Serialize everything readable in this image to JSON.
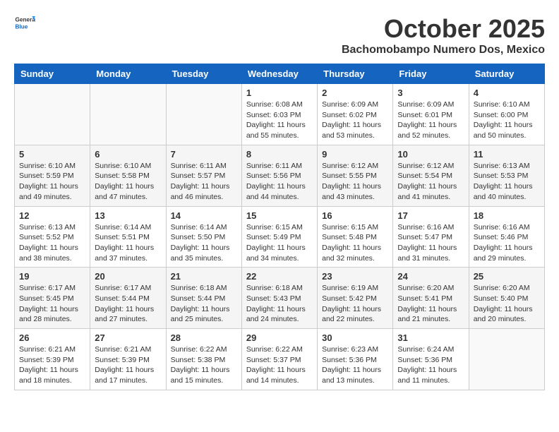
{
  "header": {
    "logo_general": "General",
    "logo_blue": "Blue",
    "month": "October 2025",
    "location": "Bachomobampo Numero Dos, Mexico"
  },
  "days_of_week": [
    "Sunday",
    "Monday",
    "Tuesday",
    "Wednesday",
    "Thursday",
    "Friday",
    "Saturday"
  ],
  "weeks": [
    [
      {
        "day": "",
        "info": ""
      },
      {
        "day": "",
        "info": ""
      },
      {
        "day": "",
        "info": ""
      },
      {
        "day": "1",
        "sunrise": "6:08 AM",
        "sunset": "6:03 PM",
        "daylight": "11 hours and 55 minutes."
      },
      {
        "day": "2",
        "sunrise": "6:09 AM",
        "sunset": "6:02 PM",
        "daylight": "11 hours and 53 minutes."
      },
      {
        "day": "3",
        "sunrise": "6:09 AM",
        "sunset": "6:01 PM",
        "daylight": "11 hours and 52 minutes."
      },
      {
        "day": "4",
        "sunrise": "6:10 AM",
        "sunset": "6:00 PM",
        "daylight": "11 hours and 50 minutes."
      }
    ],
    [
      {
        "day": "5",
        "sunrise": "6:10 AM",
        "sunset": "5:59 PM",
        "daylight": "11 hours and 49 minutes."
      },
      {
        "day": "6",
        "sunrise": "6:10 AM",
        "sunset": "5:58 PM",
        "daylight": "11 hours and 47 minutes."
      },
      {
        "day": "7",
        "sunrise": "6:11 AM",
        "sunset": "5:57 PM",
        "daylight": "11 hours and 46 minutes."
      },
      {
        "day": "8",
        "sunrise": "6:11 AM",
        "sunset": "5:56 PM",
        "daylight": "11 hours and 44 minutes."
      },
      {
        "day": "9",
        "sunrise": "6:12 AM",
        "sunset": "5:55 PM",
        "daylight": "11 hours and 43 minutes."
      },
      {
        "day": "10",
        "sunrise": "6:12 AM",
        "sunset": "5:54 PM",
        "daylight": "11 hours and 41 minutes."
      },
      {
        "day": "11",
        "sunrise": "6:13 AM",
        "sunset": "5:53 PM",
        "daylight": "11 hours and 40 minutes."
      }
    ],
    [
      {
        "day": "12",
        "sunrise": "6:13 AM",
        "sunset": "5:52 PM",
        "daylight": "11 hours and 38 minutes."
      },
      {
        "day": "13",
        "sunrise": "6:14 AM",
        "sunset": "5:51 PM",
        "daylight": "11 hours and 37 minutes."
      },
      {
        "day": "14",
        "sunrise": "6:14 AM",
        "sunset": "5:50 PM",
        "daylight": "11 hours and 35 minutes."
      },
      {
        "day": "15",
        "sunrise": "6:15 AM",
        "sunset": "5:49 PM",
        "daylight": "11 hours and 34 minutes."
      },
      {
        "day": "16",
        "sunrise": "6:15 AM",
        "sunset": "5:48 PM",
        "daylight": "11 hours and 32 minutes."
      },
      {
        "day": "17",
        "sunrise": "6:16 AM",
        "sunset": "5:47 PM",
        "daylight": "11 hours and 31 minutes."
      },
      {
        "day": "18",
        "sunrise": "6:16 AM",
        "sunset": "5:46 PM",
        "daylight": "11 hours and 29 minutes."
      }
    ],
    [
      {
        "day": "19",
        "sunrise": "6:17 AM",
        "sunset": "5:45 PM",
        "daylight": "11 hours and 28 minutes."
      },
      {
        "day": "20",
        "sunrise": "6:17 AM",
        "sunset": "5:44 PM",
        "daylight": "11 hours and 27 minutes."
      },
      {
        "day": "21",
        "sunrise": "6:18 AM",
        "sunset": "5:44 PM",
        "daylight": "11 hours and 25 minutes."
      },
      {
        "day": "22",
        "sunrise": "6:18 AM",
        "sunset": "5:43 PM",
        "daylight": "11 hours and 24 minutes."
      },
      {
        "day": "23",
        "sunrise": "6:19 AM",
        "sunset": "5:42 PM",
        "daylight": "11 hours and 22 minutes."
      },
      {
        "day": "24",
        "sunrise": "6:20 AM",
        "sunset": "5:41 PM",
        "daylight": "11 hours and 21 minutes."
      },
      {
        "day": "25",
        "sunrise": "6:20 AM",
        "sunset": "5:40 PM",
        "daylight": "11 hours and 20 minutes."
      }
    ],
    [
      {
        "day": "26",
        "sunrise": "6:21 AM",
        "sunset": "5:39 PM",
        "daylight": "11 hours and 18 minutes."
      },
      {
        "day": "27",
        "sunrise": "6:21 AM",
        "sunset": "5:39 PM",
        "daylight": "11 hours and 17 minutes."
      },
      {
        "day": "28",
        "sunrise": "6:22 AM",
        "sunset": "5:38 PM",
        "daylight": "11 hours and 15 minutes."
      },
      {
        "day": "29",
        "sunrise": "6:22 AM",
        "sunset": "5:37 PM",
        "daylight": "11 hours and 14 minutes."
      },
      {
        "day": "30",
        "sunrise": "6:23 AM",
        "sunset": "5:36 PM",
        "daylight": "11 hours and 13 minutes."
      },
      {
        "day": "31",
        "sunrise": "6:24 AM",
        "sunset": "5:36 PM",
        "daylight": "11 hours and 11 minutes."
      },
      {
        "day": "",
        "info": ""
      }
    ]
  ],
  "labels": {
    "sunrise_prefix": "Sunrise: ",
    "sunset_prefix": "Sunset: ",
    "daylight_prefix": "Daylight: "
  }
}
